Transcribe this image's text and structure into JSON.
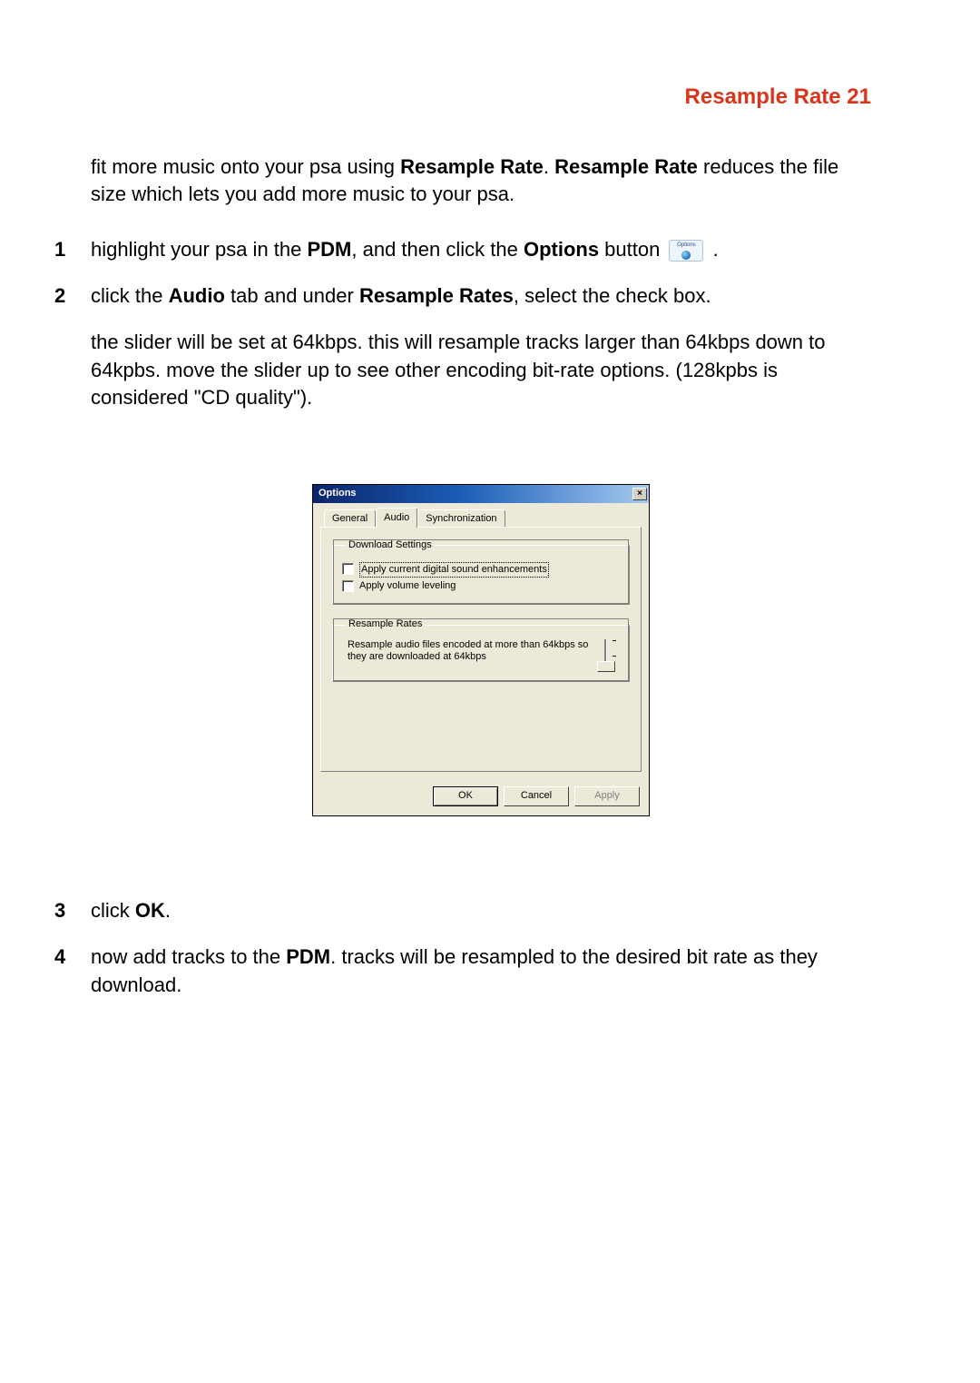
{
  "header": {
    "title": "Resample Rate 21"
  },
  "intro": {
    "pre": "fit more music onto your psa using ",
    "b1": "Resample Rate",
    "mid": ". ",
    "b2": "Resample Rate",
    "post": " reduces the file size which lets you add more music to your psa."
  },
  "steps": {
    "s1": {
      "a": "highlight your psa in the ",
      "b1": "PDM",
      "b": ", and then click the ",
      "b2": "Options",
      "c": " button ",
      "icon_label": "Options",
      "d": " ."
    },
    "s2": {
      "p1a": "click the ",
      "p1b": "Audio",
      "p1c": " tab and under ",
      "p1d": "Resample Rates",
      "p1e": ", select the check box.",
      "p2": "the slider will be set at 64kbps. this will resample tracks larger than 64kbps down to 64kpbs. move the slider up to see other encoding bit-rate options. (128kpbs is considered \"CD quality\")."
    },
    "s3": {
      "a": "click ",
      "b": "OK",
      "c": "."
    },
    "s4": {
      "a": "now add tracks to the ",
      "b": "PDM",
      "c": ". tracks will be resampled to the desired bit rate as they download."
    }
  },
  "dialog": {
    "title": "Options",
    "close": "×",
    "tabs": {
      "general": "General",
      "audio": "Audio",
      "sync": "Synchronization"
    },
    "group1": {
      "legend": "Download Settings",
      "cb1": "Apply current digital sound enhancements",
      "cb2": "Apply volume leveling"
    },
    "group2": {
      "legend": "Resample Rates",
      "text": "Resample audio files encoded at more than 64kbps so they are downloaded at 64kbps"
    },
    "buttons": {
      "ok": "OK",
      "cancel": "Cancel",
      "apply": "Apply"
    }
  }
}
